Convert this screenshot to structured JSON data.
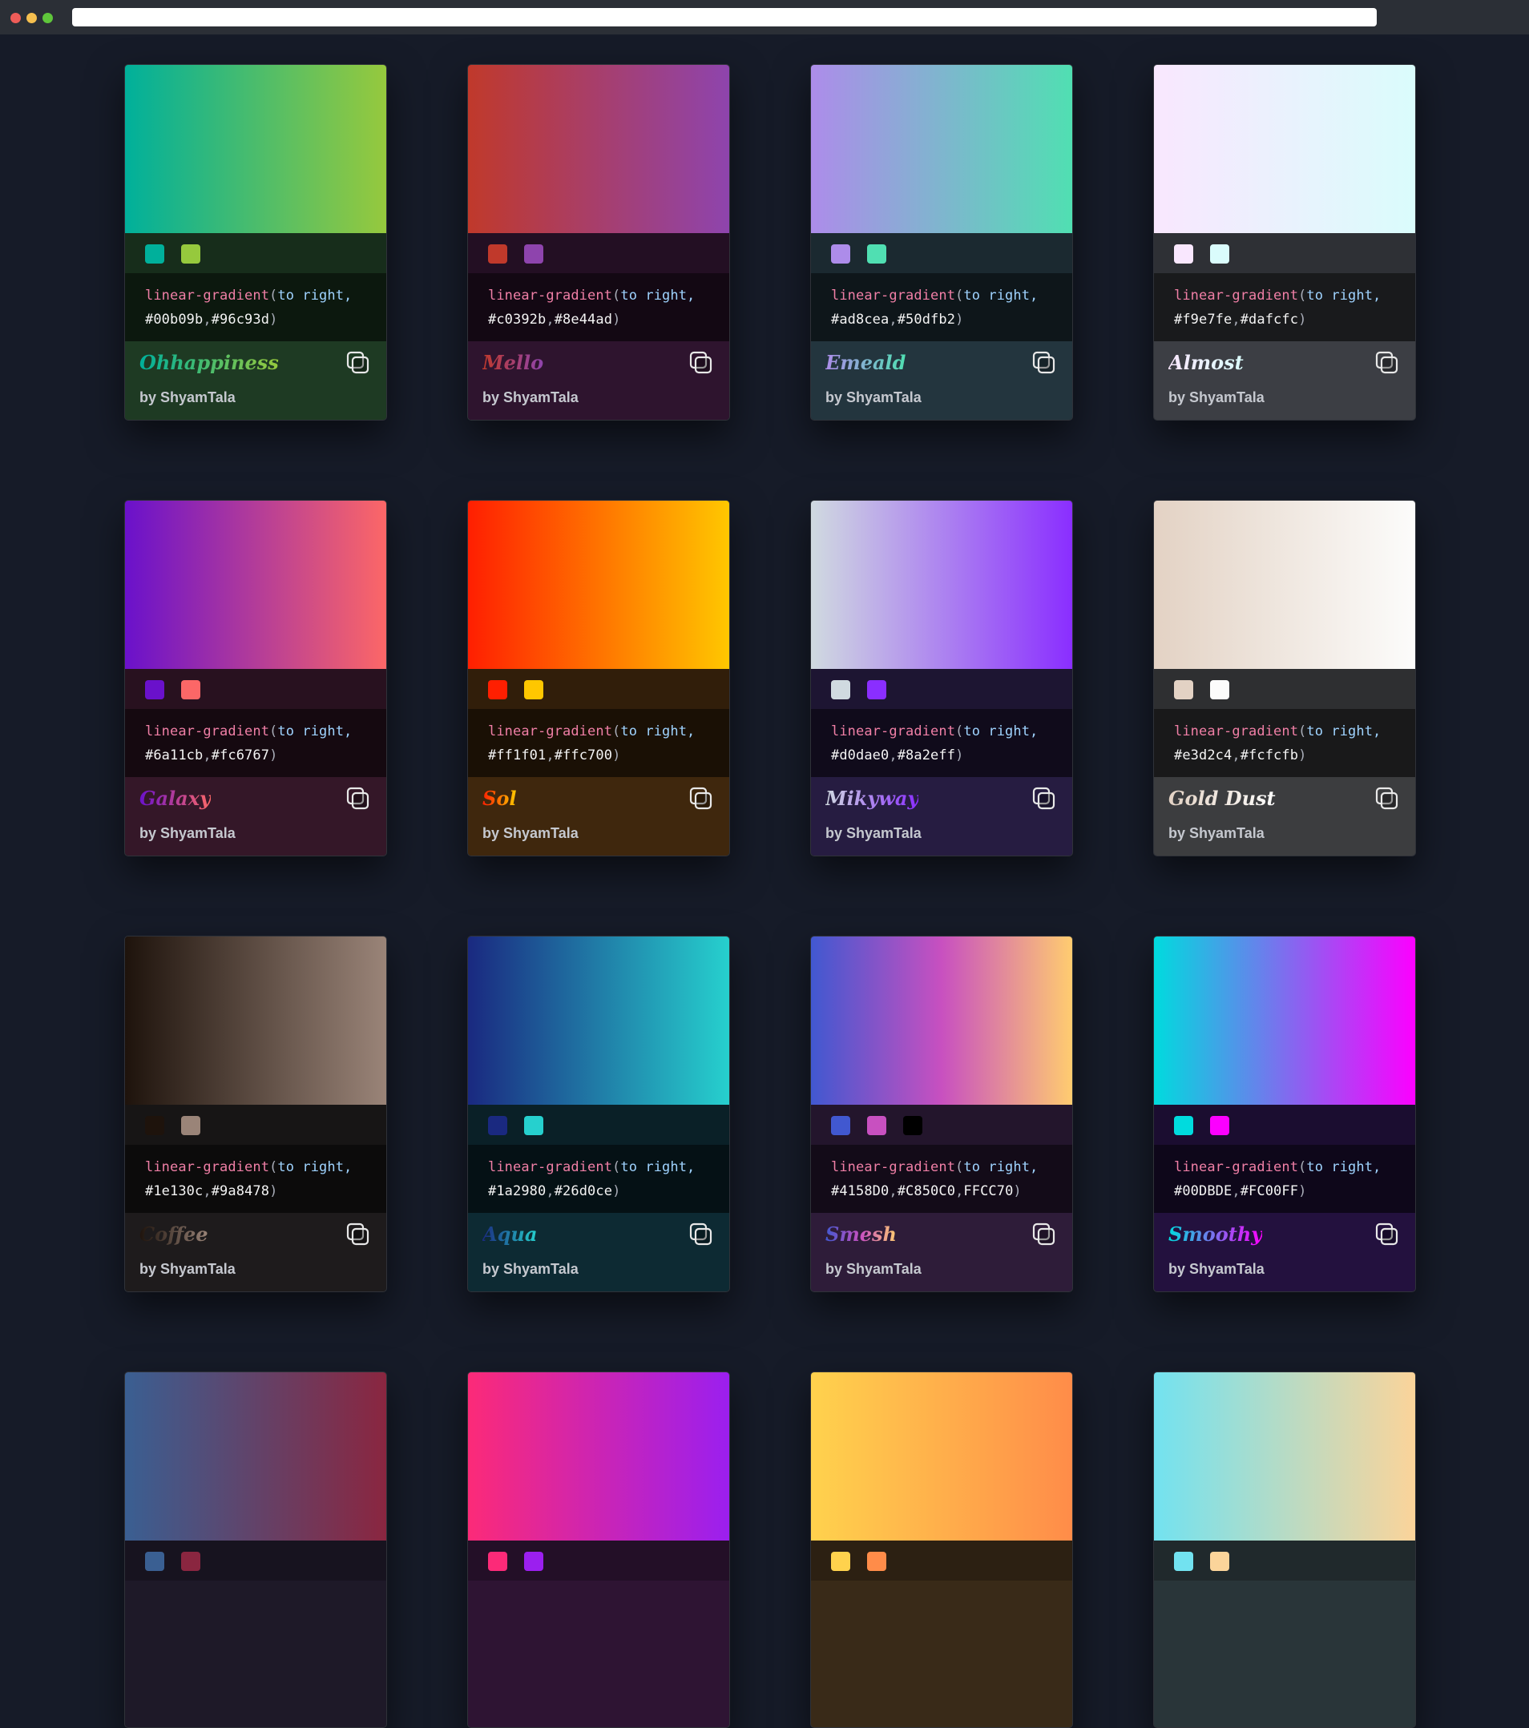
{
  "window": {
    "url": ""
  },
  "cards": [
    {
      "name": "Ohhappiness",
      "author": "by ShyamTala",
      "colors": [
        "#00b09b",
        "#96c93d"
      ],
      "hex": [
        "#00b09b",
        "#96c93d"
      ],
      "tint": "rgba(40,90,40,0.55)"
    },
    {
      "name": "Mello",
      "author": "by ShyamTala",
      "colors": [
        "#c0392b",
        "#8e44ad"
      ],
      "hex": [
        "#c0392b",
        "#8e44ad"
      ],
      "tint": "rgba(70,20,60,0.55)"
    },
    {
      "name": "Emeald",
      "author": "by ShyamTala",
      "colors": [
        "#ad8cea",
        "#50dfb2"
      ],
      "hex": [
        "#ad8cea",
        "#50dfb2"
      ],
      "tint": "rgba(50,80,90,0.55)"
    },
    {
      "name": "Almost",
      "author": "by ShyamTala",
      "colors": [
        "#f9e7fe",
        "#dafcfc"
      ],
      "hex": [
        "#f9e7fe",
        "#dafcfc"
      ],
      "tint": "rgba(110,110,115,0.45)"
    },
    {
      "name": "Galaxy",
      "author": "by ShyamTala",
      "colors": [
        "#6a11cb",
        "#fc6767"
      ],
      "hex": [
        "#6a11cb",
        "#fc6767"
      ],
      "tint": "rgba(80,25,50,0.55)"
    },
    {
      "name": "Sol",
      "author": "by ShyamTala",
      "colors": [
        "#ff1f01",
        "#ffc700"
      ],
      "hex": [
        "#ff1f01",
        "#ffc700"
      ],
      "tint": "rgba(100,55,0,0.55)"
    },
    {
      "name": "Mikyway",
      "author": "by ShyamTala",
      "colors": [
        "#d0dae0",
        "#8a2eff"
      ],
      "hex": [
        "#d0dae0",
        "#8a2eff"
      ],
      "tint": "rgba(55,35,95,0.55)"
    },
    {
      "name": "Gold Dust",
      "author": "by ShyamTala",
      "colors": [
        "#e3d2c4",
        "#fcfcfb"
      ],
      "hex": [
        "#e3d2c4",
        "#fcfcfb"
      ],
      "tint": "rgba(110,108,105,0.45)"
    },
    {
      "name": "Coffee",
      "author": "by ShyamTala",
      "colors": [
        "#1e130c",
        "#9a8478"
      ],
      "hex": [
        "#1e130c",
        "#9a8478"
      ],
      "tint": "rgba(40,32,28,0.55)"
    },
    {
      "name": "Aqua",
      "author": "by ShyamTala",
      "colors": [
        "#1a2980",
        "#26d0ce"
      ],
      "hex": [
        "#1a2980",
        "#26d0ce"
      ],
      "tint": "rgba(10,60,70,0.55)"
    },
    {
      "name": "Smesh",
      "author": "by ShyamTala",
      "colors": [
        "#4158D0",
        "#C850C0",
        "#FFCC70"
      ],
      "hex": [
        "#4158D0",
        "#C850C0",
        "FFCC70"
      ],
      "swatches": [
        "#4158D0",
        "#C850C0",
        "#000000"
      ],
      "tint": "rgba(70,35,80,0.55)"
    },
    {
      "name": "Smoothy",
      "author": "by ShyamTala",
      "colors": [
        "#00DBDE",
        "#FC00FF"
      ],
      "hex": [
        "#00DBDE",
        "#FC00FF"
      ],
      "tint": "rgba(50,15,90,0.55)"
    },
    {
      "name": "",
      "author": "",
      "colors": [
        "#3a5f92",
        "#8a2640"
      ],
      "hex": [],
      "swatches": [
        "#3a5f92",
        "#8a2640"
      ],
      "tint": "rgba(40,30,50,0.55)"
    },
    {
      "name": "",
      "author": "",
      "colors": [
        "#fc2a78",
        "#9b1fef"
      ],
      "hex": [],
      "swatches": [
        "#fc2a78",
        "#9b1fef"
      ],
      "tint": "rgba(70,20,70,0.55)"
    },
    {
      "name": "",
      "author": "",
      "colors": [
        "#ffd24d",
        "#ff8c49"
      ],
      "hex": [],
      "swatches": [
        "#ffd24d",
        "#ff8c49"
      ],
      "tint": "rgba(90,60,20,0.55)"
    },
    {
      "name": "",
      "author": "",
      "colors": [
        "#72e2f0",
        "#fbd49a"
      ],
      "hex": [],
      "swatches": [
        "#72e2f0",
        "#fbd49a"
      ],
      "tint": "rgba(60,80,80,0.55)"
    }
  ],
  "code": {
    "fn": "linear-gradient",
    "direction": "to right,"
  },
  "icons": {
    "copy": "copy-icon"
  }
}
